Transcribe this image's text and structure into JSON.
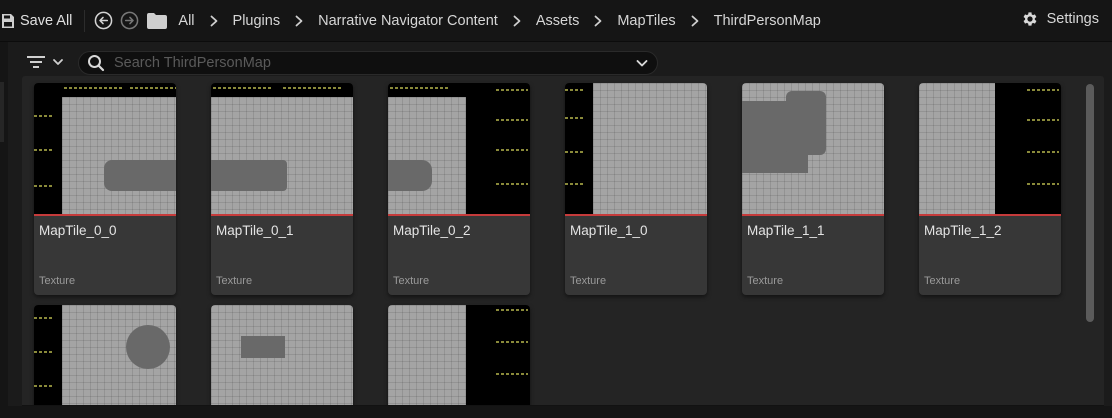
{
  "toolbar": {
    "save_all_label": "Save All",
    "save_icon": "save-icon",
    "back_icon": "back-arrow-icon",
    "forward_icon": "forward-arrow-icon",
    "folder_icon": "folder-icon",
    "breadcrumbs": [
      "All",
      "Plugins",
      "Narrative Navigator Content",
      "Assets",
      "MapTiles",
      "ThirdPersonMap"
    ],
    "settings_label": "Settings",
    "settings_icon": "gear-icon"
  },
  "filter": {
    "filter_icon": "filter-icon",
    "search_icon": "search-icon",
    "search_placeholder": "Search ThirdPersonMap",
    "search_value": ""
  },
  "assets": [
    {
      "name": "MapTile_0_0",
      "type": "Texture"
    },
    {
      "name": "MapTile_0_1",
      "type": "Texture"
    },
    {
      "name": "MapTile_0_2",
      "type": "Texture"
    },
    {
      "name": "MapTile_1_0",
      "type": "Texture"
    },
    {
      "name": "MapTile_1_1",
      "type": "Texture"
    },
    {
      "name": "MapTile_1_2",
      "type": "Texture"
    },
    {
      "name": "",
      "type": ""
    },
    {
      "name": "",
      "type": ""
    },
    {
      "name": "",
      "type": ""
    }
  ],
  "colors": {
    "accent_underline": "#c63b3b",
    "tile_bg": "#373737",
    "panel_bg": "#242424",
    "toolbar_bg": "#151515"
  }
}
